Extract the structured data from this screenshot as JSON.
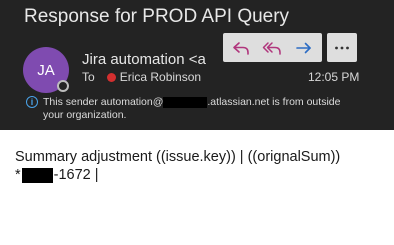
{
  "email": {
    "subject": "Response for PROD API Query",
    "avatar_initials": "JA",
    "avatar_color": "#7f4bb0",
    "sender_name": "Jira automation <a",
    "to_label": "To",
    "recipient": "Erica Robinson",
    "recipient_status_color": "#d32f2f",
    "time": "12:05 PM",
    "warning": {
      "icon": "info-icon",
      "text_before": "This sender automation@",
      "text_after": ".atlassian.net is from outside your organization."
    },
    "body": {
      "line1": "Summary adjustment ((issue.key)) | ((orignalSum))",
      "line2_prefix": "*",
      "line2_suffix": "-1672 |"
    }
  },
  "actions": {
    "reply_icon": "reply-icon",
    "reply_all_icon": "reply-all-icon",
    "forward_icon": "forward-icon",
    "more_icon": "more-options-icon",
    "reply_color": "#b0357c",
    "forward_color": "#2b6cc4"
  }
}
